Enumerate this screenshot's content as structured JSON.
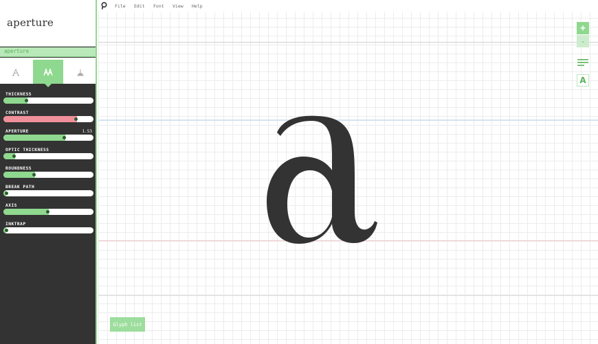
{
  "app": {
    "preview_text": "aperture",
    "font_name": "aperture"
  },
  "mode_tabs": [
    {
      "icon": "serif-letter-icon"
    },
    {
      "icon": "font-style-icon",
      "active": true
    },
    {
      "icon": "glyph-shape-icon"
    }
  ],
  "parameters": [
    {
      "label": "THICKNESS",
      "value": "",
      "fraction": 0.27,
      "color": "#8fd88f"
    },
    {
      "label": "CONTRAST",
      "value": "",
      "fraction": 0.82,
      "color": "#f0909a"
    },
    {
      "label": "APERTURE",
      "value": "1.53",
      "fraction": 0.69,
      "color": "#8fd88f"
    },
    {
      "label": "OPTIC THICKNESS",
      "value": "",
      "fraction": 0.13,
      "color": "#8fd88f"
    },
    {
      "label": "ROUNDNESS",
      "value": "",
      "fraction": 0.35,
      "color": "#8fd88f"
    },
    {
      "label": "BREAK PATH",
      "value": "",
      "fraction": 0.03,
      "color": "#8fd88f"
    },
    {
      "label": "AXIS",
      "value": "",
      "fraction": 0.5,
      "color": "#8fd88f"
    },
    {
      "label": "INKTRAP",
      "value": "",
      "fraction": 0.03,
      "color": "#8fd88f"
    }
  ],
  "menu": {
    "file": "File",
    "edit": "Edit",
    "font": "Font",
    "view": "View",
    "help": "Help"
  },
  "canvas": {
    "glyph": "a"
  },
  "toolbar": {
    "zoom_in": "+",
    "zoom_out": "-",
    "font_button": "A"
  },
  "glyph_list_label": "Glyph list",
  "colors": {
    "accent": "#8fd88f",
    "sidebar_bg": "#333333",
    "contrast_slider": "#f0909a"
  }
}
